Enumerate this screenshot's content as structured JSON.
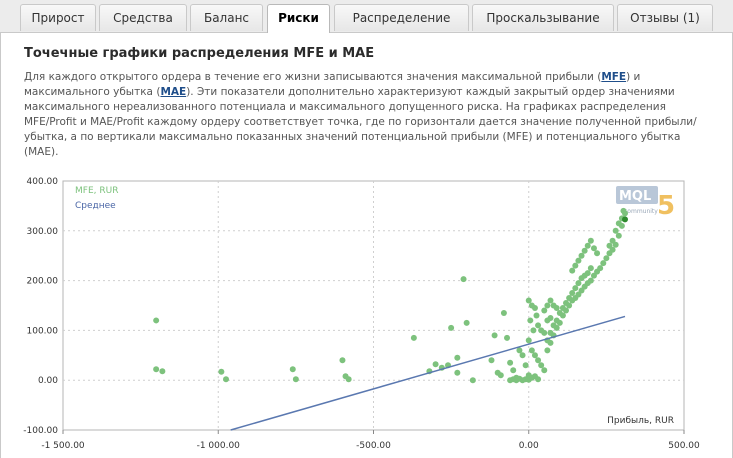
{
  "tabs": [
    {
      "label": "Прирост",
      "active": false
    },
    {
      "label": "Средства",
      "active": false
    },
    {
      "label": "Баланс",
      "active": false
    },
    {
      "label": "Риски",
      "active": true
    },
    {
      "label": "Распределение",
      "active": false
    },
    {
      "label": "Проскальзывание",
      "active": false
    },
    {
      "label": "Отзывы (1)",
      "active": false
    }
  ],
  "section": {
    "title": "Точечные графики распределения MFE и MAE",
    "desc_p1": "Для каждого открытого ордера в течение его жизни записываются значения максимальной прибыли (",
    "link_mfe": "MFE",
    "desc_p2": ") и максимального убытка (",
    "link_mae": "MAE",
    "desc_p3": "). Эти показатели дополнительно характеризуют каждый закрытый ордер значениями максимального нереализованного потенциала и максимального допущенного риска. На графиках распределения MFE/Profit и MAE/Profit каждому ордеру соответствует точка, где по горизонтали дается значение полученной прибыли/убытка, а по вертикали максимально показанных значений потенциальной прибыли (MFE) и потенциального убытка (MAE)."
  },
  "watermark": {
    "text": "MQL",
    "digit": "5",
    "sub": "community"
  },
  "colors": {
    "points": "#7dc27d",
    "trend": "#5a78b0",
    "highlight": "#2e8b2e",
    "grid": "#cfcfcf"
  },
  "chart_data": {
    "type": "scatter",
    "xlabel": "Прибыль, RUR",
    "xlim": [
      -1500,
      500
    ],
    "ylim": [
      -100,
      400
    ],
    "xticks": [
      -1500,
      -1000,
      -500,
      0,
      500
    ],
    "yticks": [
      400,
      300,
      200,
      100,
      0,
      -100
    ],
    "xtick_labels": [
      "-1 500.00",
      "-1 000.00",
      "-500.00",
      "0.00",
      "500.00"
    ],
    "ytick_labels": [
      "400.00",
      "300.00",
      "200.00",
      "100.00",
      "0.00",
      "-100.00"
    ],
    "grid": true,
    "legend_position": "top-left",
    "series": [
      {
        "name": "MFE, RUR",
        "points": [
          [
            -1200,
            120
          ],
          [
            -1200,
            22
          ],
          [
            -1180,
            18
          ],
          [
            -990,
            17
          ],
          [
            -975,
            2
          ],
          [
            -760,
            22
          ],
          [
            -750,
            2
          ],
          [
            -600,
            40
          ],
          [
            -590,
            8
          ],
          [
            -580,
            2
          ],
          [
            -370,
            85
          ],
          [
            -320,
            18
          ],
          [
            -300,
            32
          ],
          [
            -280,
            25
          ],
          [
            -260,
            30
          ],
          [
            -250,
            105
          ],
          [
            -230,
            45
          ],
          [
            -200,
            115
          ],
          [
            -230,
            15
          ],
          [
            -210,
            203
          ],
          [
            -180,
            0
          ],
          [
            -120,
            40
          ],
          [
            -110,
            90
          ],
          [
            -100,
            15
          ],
          [
            -90,
            10
          ],
          [
            -80,
            135
          ],
          [
            -70,
            85
          ],
          [
            -60,
            35
          ],
          [
            -50,
            20
          ],
          [
            -40,
            5
          ],
          [
            -30,
            60
          ],
          [
            -20,
            50
          ],
          [
            -10,
            30
          ],
          [
            0,
            10
          ],
          [
            -60,
            0
          ],
          [
            -50,
            2
          ],
          [
            -40,
            0
          ],
          [
            -30,
            3
          ],
          [
            -20,
            0
          ],
          [
            -10,
            2
          ],
          [
            0,
            1
          ],
          [
            10,
            5
          ],
          [
            20,
            8
          ],
          [
            30,
            2
          ],
          [
            0,
            160
          ],
          [
            10,
            150
          ],
          [
            5,
            120
          ],
          [
            15,
            100
          ],
          [
            20,
            145
          ],
          [
            25,
            130
          ],
          [
            0,
            80
          ],
          [
            10,
            60
          ],
          [
            20,
            50
          ],
          [
            30,
            40
          ],
          [
            40,
            30
          ],
          [
            50,
            20
          ],
          [
            60,
            60
          ],
          [
            70,
            75
          ],
          [
            80,
            90
          ],
          [
            90,
            105
          ],
          [
            100,
            115
          ],
          [
            110,
            130
          ],
          [
            120,
            140
          ],
          [
            130,
            150
          ],
          [
            140,
            160
          ],
          [
            150,
            165
          ],
          [
            160,
            172
          ],
          [
            170,
            180
          ],
          [
            180,
            188
          ],
          [
            190,
            195
          ],
          [
            200,
            200
          ],
          [
            210,
            210
          ],
          [
            220,
            218
          ],
          [
            230,
            225
          ],
          [
            240,
            235
          ],
          [
            250,
            245
          ],
          [
            260,
            255
          ],
          [
            270,
            262
          ],
          [
            280,
            272
          ],
          [
            290,
            290
          ],
          [
            300,
            310
          ],
          [
            60,
            80
          ],
          [
            70,
            95
          ],
          [
            80,
            110
          ],
          [
            90,
            120
          ],
          [
            100,
            135
          ],
          [
            110,
            145
          ],
          [
            120,
            155
          ],
          [
            130,
            165
          ],
          [
            140,
            175
          ],
          [
            150,
            185
          ],
          [
            160,
            195
          ],
          [
            170,
            205
          ],
          [
            180,
            210
          ],
          [
            190,
            215
          ],
          [
            200,
            225
          ],
          [
            140,
            220
          ],
          [
            150,
            230
          ],
          [
            160,
            240
          ],
          [
            170,
            250
          ],
          [
            180,
            260
          ],
          [
            190,
            270
          ],
          [
            200,
            280
          ],
          [
            210,
            265
          ],
          [
            220,
            255
          ],
          [
            50,
            140
          ],
          [
            60,
            150
          ],
          [
            70,
            160
          ],
          [
            80,
            150
          ],
          [
            90,
            145
          ],
          [
            30,
            110
          ],
          [
            40,
            100
          ],
          [
            50,
            95
          ],
          [
            60,
            120
          ],
          [
            70,
            125
          ],
          [
            260,
            270
          ],
          [
            270,
            280
          ],
          [
            280,
            300
          ],
          [
            290,
            315
          ],
          [
            300,
            325
          ],
          [
            310,
            335
          ],
          [
            305,
            340
          ]
        ]
      },
      {
        "name": "Среднее",
        "line": [
          [
            -960,
            -100
          ],
          [
            310,
            128
          ]
        ]
      }
    ],
    "highlight_point": [
      310,
      323
    ]
  }
}
